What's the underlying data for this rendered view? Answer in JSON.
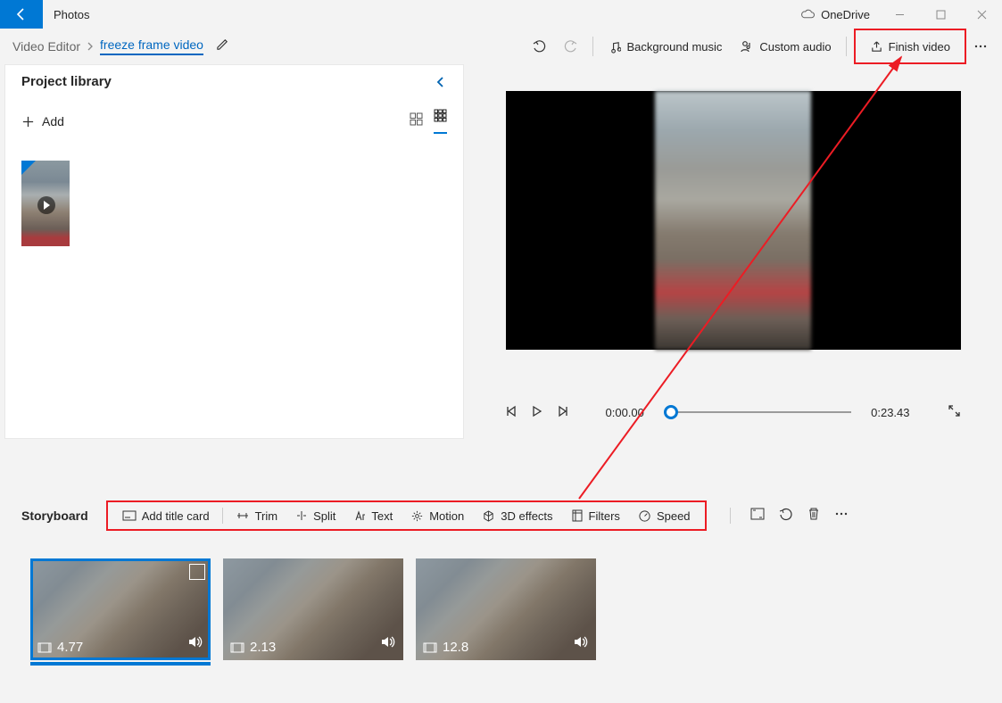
{
  "titlebar": {
    "app": "Photos",
    "onedrive": "OneDrive"
  },
  "breadcrumb": {
    "root": "Video Editor",
    "project": "freeze frame video"
  },
  "toolbar": {
    "bg_music": "Background music",
    "custom_audio": "Custom audio",
    "finish": "Finish video"
  },
  "library": {
    "title": "Project library",
    "add": "Add"
  },
  "preview": {
    "current_time": "0:00.00",
    "total_time": "0:23.43"
  },
  "storyboard": {
    "label": "Storyboard",
    "tools": {
      "title_card": "Add title card",
      "trim": "Trim",
      "split": "Split",
      "text": "Text",
      "motion": "Motion",
      "effects3d": "3D effects",
      "filters": "Filters",
      "speed": "Speed"
    }
  },
  "clips": [
    {
      "duration": "4.77",
      "selected": true
    },
    {
      "duration": "2.13",
      "selected": false
    },
    {
      "duration": "12.8",
      "selected": false
    }
  ]
}
